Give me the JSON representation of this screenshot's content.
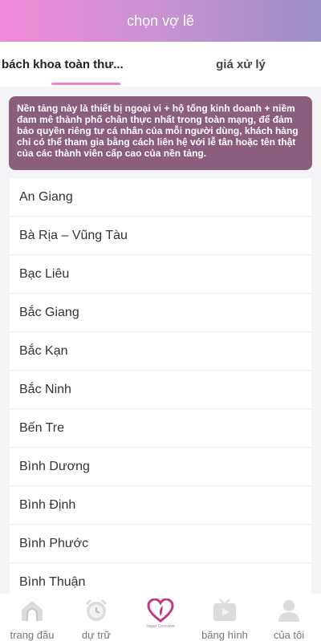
{
  "header": {
    "title": "chọn vợ lẽ"
  },
  "tabs": [
    {
      "label": "bách khoa toàn thư...",
      "active": true
    },
    {
      "label": "giá xử lý",
      "active": false
    }
  ],
  "notice": {
    "text": "Nền tảng này là thiết bị ngoại vi + hộ tống kinh doanh + niềm đam mê thành phố chân thực nhất trong toàn mạng, để đảm bảo quyền riêng tư cá nhân của mỗi người dùng, khách hàng chỉ có thể tham gia bằng cách liên hệ với lễ tân hoặc tên thật của các thành viên cấp cao của nền tảng."
  },
  "provinces": [
    "An Giang",
    "Bà Rịa – Vũng Tàu",
    "Bạc Liêu",
    "Bắc Giang",
    "Bắc Kạn",
    "Bắc Ninh",
    "Bến Tre",
    "Bình Dương",
    "Bình Định",
    "Bình Phước",
    "Bình Thuận"
  ],
  "tabbar": {
    "items": [
      {
        "label": "trang đầu",
        "icon": "home-icon"
      },
      {
        "label": "dự trữ",
        "icon": "alarm-clock-icon"
      },
      {
        "label": "Vagar Conclave",
        "icon": "heart-logo-icon"
      },
      {
        "label": "băng hình",
        "icon": "tv-play-icon"
      },
      {
        "label": "của tôi",
        "icon": "user-icon"
      }
    ]
  },
  "colors": {
    "header_gradient_start": "#f28ad8",
    "header_gradient_end": "#9b90c4",
    "tab_underline": "#e884d8",
    "notice_bg": "#8b5e7d",
    "icon_gray": "#d8d8d8",
    "logo_pink": "#c2387e"
  }
}
